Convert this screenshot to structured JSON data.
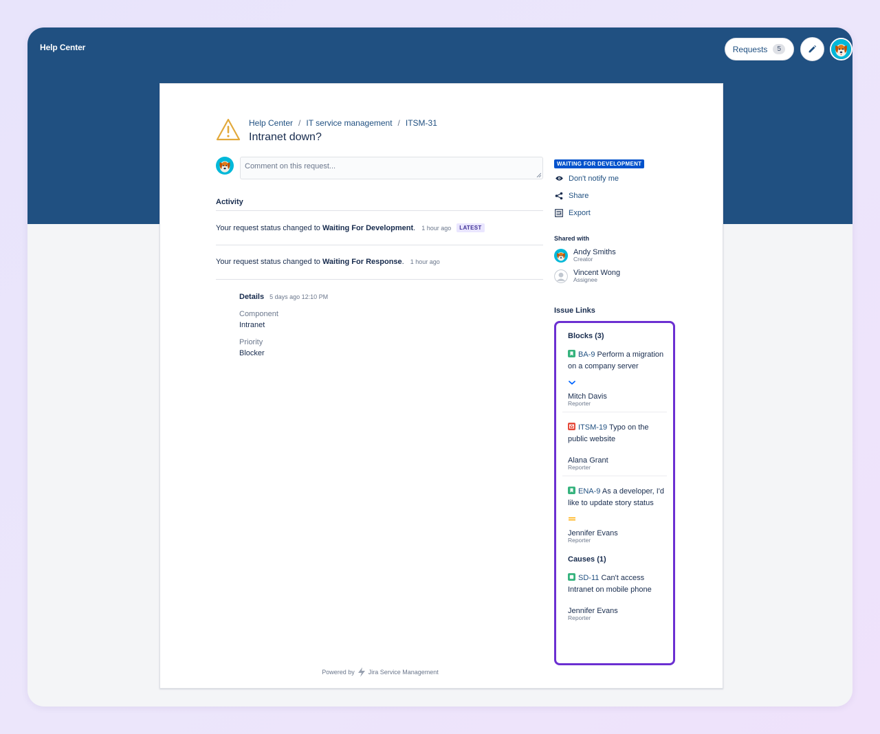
{
  "header": {
    "title": "Help Center",
    "requests_label": "Requests",
    "requests_count": "5"
  },
  "breadcrumb": [
    {
      "label": "Help Center"
    },
    {
      "label": "IT service management"
    },
    {
      "label": "ITSM-31"
    }
  ],
  "request": {
    "title": "Intranet down?"
  },
  "comment": {
    "placeholder": "Comment on this request..."
  },
  "activity": {
    "heading": "Activity",
    "items": [
      {
        "prefix": "Your request status changed to",
        "status": "Waiting For Development",
        "suffix": ".",
        "time": "1 hour ago",
        "badge": "LATEST"
      },
      {
        "prefix": "Your request status changed to",
        "status": "Waiting For Response",
        "suffix": ".",
        "time": "1 hour ago"
      }
    ]
  },
  "details": {
    "heading": "Details",
    "time": "5 days ago 12:10 PM",
    "fields": [
      {
        "label": "Component",
        "value": "Intranet"
      },
      {
        "label": "Priority",
        "value": "Blocker"
      }
    ]
  },
  "sidebar": {
    "status": "WAITING FOR DEVELOPMENT",
    "status_color": "#0052cc",
    "actions": [
      {
        "label": "Don't notify me",
        "icon": "eye-icon"
      },
      {
        "label": "Share",
        "icon": "share-icon"
      },
      {
        "label": "Export",
        "icon": "export-icon"
      }
    ],
    "shared_heading": "Shared with",
    "people": [
      {
        "name": "Andy Smiths",
        "role": "Creator"
      },
      {
        "name": "Vincent Wong",
        "role": "Assignee"
      }
    ]
  },
  "issue_links": {
    "heading": "Issue Links",
    "highlight_color": "#6b2fd1",
    "groups": [
      {
        "title": "Blocks (3)",
        "items": [
          {
            "key": "BA-9",
            "summary": "Perform a migration on a company server",
            "type_icon": "story-icon",
            "priority_icon": "chevron-down-icon",
            "reporter": "Mitch Davis",
            "role": "Reporter"
          },
          {
            "key": "ITSM-19",
            "summary": "Typo on the public website",
            "type_icon": "incident-icon",
            "reporter": "Alana Grant",
            "role": "Reporter"
          },
          {
            "key": "ENA-9",
            "summary": "As a developer, I'd like to update story status",
            "type_icon": "story-icon",
            "priority_icon": "medium-priority-icon",
            "reporter": "Jennifer Evans",
            "role": "Reporter"
          }
        ]
      },
      {
        "title": "Causes (1)",
        "items": [
          {
            "key": "SD-11",
            "summary": "Can't access Intranet on mobile phone",
            "type_icon": "service-request-icon",
            "reporter": "Jennifer Evans",
            "role": "Reporter"
          }
        ]
      }
    ]
  },
  "footer": {
    "powered_by": "Powered by",
    "product": "Jira Service Management"
  }
}
